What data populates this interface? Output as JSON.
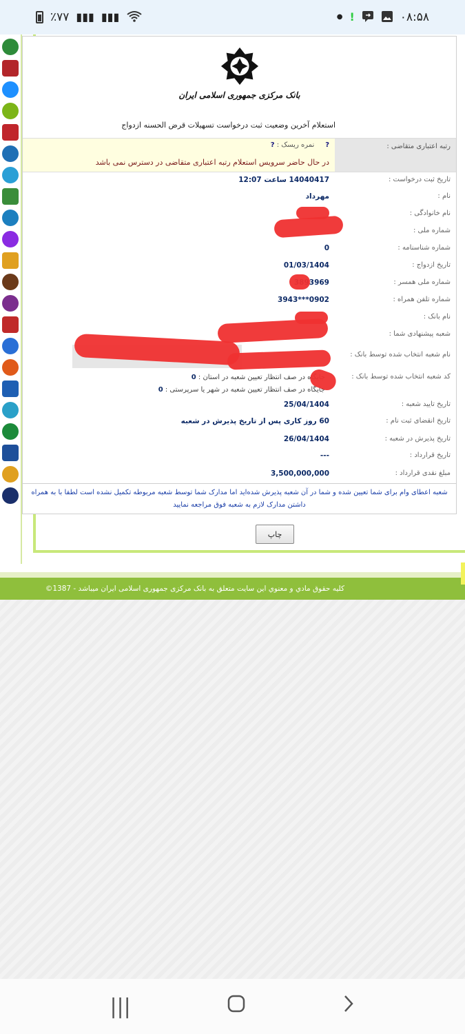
{
  "status_bar": {
    "time": "۰۸:۵۸",
    "battery": "٪۷۷"
  },
  "page": {
    "bank_name": "بانک مرکزی جمهوری اسلامی ایران",
    "heading": "استعلام آخرین وضعیت ثبت درخواست تسهیلات قرض الحسنه ازدواج",
    "rating": {
      "label": "رتبه اعتباری متقاضی :",
      "q": "?",
      "risk_label": "نمره ریسک :",
      "risk_value": "?",
      "message": "در حال حاضر سرویس استعلام رتبه اعتباری متقاضی در دسترس نمی باشد"
    },
    "rows": [
      {
        "label": "تاریخ ثبت درخواست :",
        "value": "14040417 ساعت 12:07"
      },
      {
        "label": "نام :",
        "value": "مهرداد"
      },
      {
        "label": "نام خانوادگی :",
        "value": ""
      },
      {
        "label": "شماره ملی :",
        "value": ""
      },
      {
        "label": "شماره شناسنامه :",
        "value": "0"
      },
      {
        "label": "تاریخ ازدواج :",
        "value": "01/03/1404"
      },
      {
        "label": "شماره ملی همسر :",
        "value": "3893969"
      },
      {
        "label": "شماره تلفن همراه :",
        "value": "0902***3943"
      },
      {
        "label": "نام بانک :",
        "value": ""
      },
      {
        "label": "شعبه پیشنهادی شما :",
        "value": ""
      },
      {
        "label": "نام شعبه انتخاب شده توسط بانک :",
        "value": ""
      },
      {
        "label": "کد شعبه انتخاب شده توسط بانک :",
        "value": ""
      },
      {
        "label": "تاریخ تایید شعبه :",
        "value": "25/04/1404"
      },
      {
        "label": "تاریخ انقضای ثبت نام :",
        "value": "60 روز کاری پس از تاریخ پذیرش در شعبه"
      },
      {
        "label": "تاریخ پذیرش در شعبه :",
        "value": "26/04/1404"
      },
      {
        "label": "تاریخ قرارداد :",
        "value": "---"
      },
      {
        "label": "مبلغ نقدی قرارداد :",
        "value": "3,500,000,000"
      }
    ],
    "queue": {
      "province_label": "جایگاه در صف انتظار تعیین شعبه در استان :",
      "province_value": "0",
      "city_label": "جایگاه در صف انتظار تعیین شعبه در شهر یا سرپرستی :",
      "city_value": "0"
    },
    "notice": "شعبه اعطای وام برای شما تعیین شده و شما در آن شعبه پذیرش شده‌اید اما مدارک شما توسط شعبه مربوطه تکمیل نشده است لطفا با به همراه داشتن مدارک لازم به شعبه فوق مراجعه نمایید",
    "print_button": "چاپ",
    "footer": "کلیه حقوق مادي و معنوي اين سايت متعلق به بانک مرکزی جمهوری اسلامی ایران میباشد - 1387©"
  },
  "bank_icon_colors": [
    "#2e8b3a",
    "#b3262a",
    "#1e90ff",
    "#7cb518",
    "#c0262c",
    "#1f6fb5",
    "#2a9fd6",
    "#3a8d3a",
    "#1c7fbf",
    "#8a2be2",
    "#e0a020",
    "#6b3a1a",
    "#7b2e8e",
    "#c02a2a",
    "#2a6fd6",
    "#e05a1a",
    "#1e5fb3",
    "#2aa0c8",
    "#1c8a3a",
    "#1e4f9a",
    "#e0a020",
    "#1a2f6b"
  ]
}
